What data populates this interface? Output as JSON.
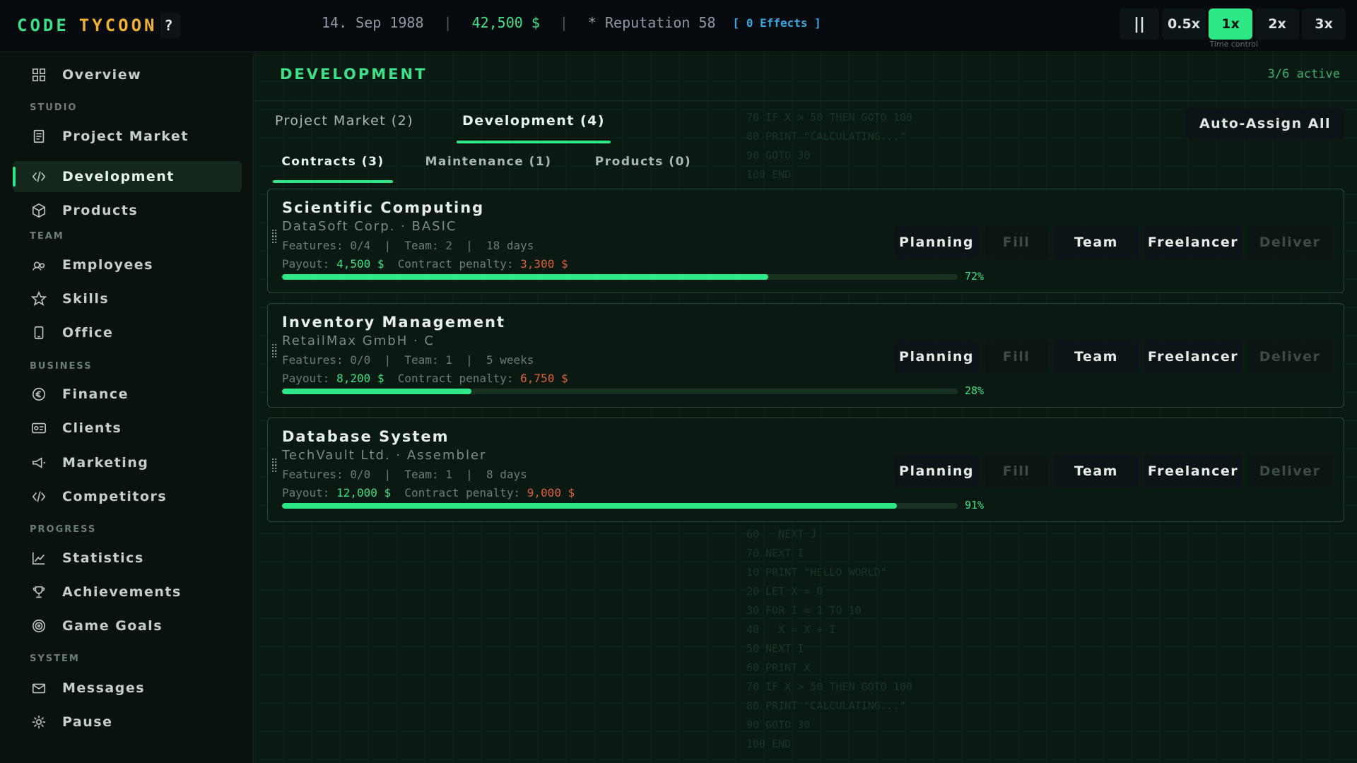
{
  "logo": {
    "word1": "CODE",
    "word2": "TYCOON",
    "help": "?"
  },
  "status": {
    "date": "14. Sep 1988",
    "sep": "|",
    "money": "42,500 $",
    "reputation": "* Reputation 58",
    "effects": "[ 0 Effects ]"
  },
  "speed": {
    "pause": "||",
    "options": [
      "0.5x",
      "1x",
      "2x",
      "3x"
    ],
    "active": "1x",
    "label": "Time control"
  },
  "sidebar": {
    "top": {
      "label": "Overview",
      "icon": "grid-icon"
    },
    "sections": [
      {
        "title": "STUDIO",
        "items": [
          {
            "label": "Project Market",
            "icon": "document-icon"
          },
          {
            "label": "Development",
            "icon": "code-icon",
            "active": true
          },
          {
            "label": "Products",
            "icon": "box-icon"
          }
        ]
      },
      {
        "title": "TEAM",
        "items": [
          {
            "label": "Employees",
            "icon": "people-icon"
          },
          {
            "label": "Skills",
            "icon": "star-icon"
          },
          {
            "label": "Office",
            "icon": "phone-icon"
          }
        ]
      },
      {
        "title": "BUSINESS",
        "items": [
          {
            "label": "Finance",
            "icon": "euro-icon"
          },
          {
            "label": "Clients",
            "icon": "id-card-icon"
          },
          {
            "label": "Marketing",
            "icon": "megaphone-icon"
          },
          {
            "label": "Competitors",
            "icon": "code-icon"
          }
        ]
      },
      {
        "title": "PROGRESS",
        "items": [
          {
            "label": "Statistics",
            "icon": "chart-icon"
          },
          {
            "label": "Achievements",
            "icon": "trophy-icon"
          },
          {
            "label": "Game Goals",
            "icon": "target-icon"
          }
        ]
      },
      {
        "title": "SYSTEM",
        "items": [
          {
            "label": "Messages",
            "icon": "mail-icon"
          },
          {
            "label": "Pause",
            "icon": "gear-icon"
          }
        ]
      }
    ]
  },
  "main": {
    "title": "DEVELOPMENT",
    "active_count": "3/6 active",
    "tabs": [
      {
        "label": "Project Market (2)",
        "active": false
      },
      {
        "label": "Development (4)",
        "active": true
      }
    ],
    "auto_assign": "Auto-Assign All",
    "subtabs": [
      {
        "label": "Contracts (3)",
        "active": true
      },
      {
        "label": "Maintenance (1)",
        "active": false
      },
      {
        "label": "Products (0)",
        "active": false
      }
    ],
    "actions": [
      "Planning",
      "Fill",
      "Team",
      "Freelancer",
      "Deliver"
    ],
    "cards": [
      {
        "title": "Scientific Computing",
        "client": "DataSoft Corp. · BASIC",
        "meta": "Features: 0/4  |  Team: 2  |  18 days",
        "payout_label": "Payout: ",
        "payout": "4,500 $",
        "penalty_label": "  Contract penalty: ",
        "penalty": "3,300 $",
        "progress": 72,
        "progress_text": "72%"
      },
      {
        "title": "Inventory Management",
        "client": "RetailMax GmbH · C",
        "meta": "Features: 0/0  |  Team: 1  |  5 weeks",
        "payout_label": "Payout: ",
        "payout": "8,200 $",
        "penalty_label": "  Contract penalty: ",
        "penalty": "6,750 $",
        "progress": 28,
        "progress_text": "28%"
      },
      {
        "title": "Database System",
        "client": "TechVault Ltd. · Assembler",
        "meta": "Features: 0/0  |  Team: 1  |  8 days",
        "payout_label": "Payout: ",
        "payout": "12,000 $",
        "penalty_label": "  Contract penalty: ",
        "penalty": "9,000 $",
        "progress": 91,
        "progress_text": "91%"
      }
    ],
    "code_top": "70 IF X > 50 THEN GOTO 100\n80 PRINT \"CALCULATING...\"\n90 GOTO 30\n100 END",
    "code_bottom": "60   NEXT J\n70 NEXT I\n10 PRINT \"HELLO WORLD\"\n20 LET X = 0\n30 FOR I = 1 TO 10\n40   X = X + I\n50 NEXT I\n60 PRINT X\n70 IF X > 50 THEN GOTO 100\n80 PRINT \"CALCULATING...\"\n90 GOTO 30\n100 END"
  }
}
